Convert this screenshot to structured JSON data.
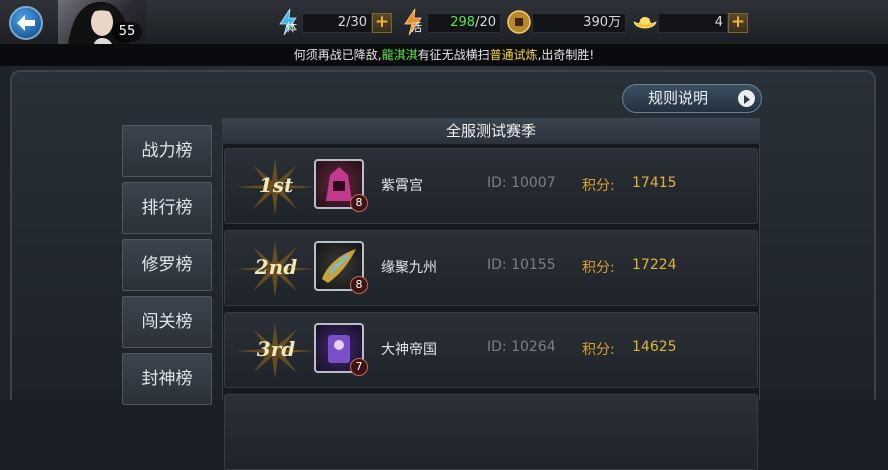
{
  "topbar": {
    "level": "55",
    "stamina": {
      "label": "体",
      "value": "2/30"
    },
    "vitality": {
      "label": "活",
      "value": "298",
      "max": "/20"
    },
    "coins": {
      "value": "390万"
    },
    "gold": {
      "value": "4"
    },
    "plus_label": "+"
  },
  "marquee": {
    "part1": "何须再战已降敌,",
    "name": "龍淇淇",
    "part2": "有征无战横扫",
    "mode": "普通试炼",
    "part3": ",出奇制胜!"
  },
  "rules_button": "规则说明",
  "tabs": [
    {
      "label": "战力榜"
    },
    {
      "label": "排行榜"
    },
    {
      "label": "修罗榜"
    },
    {
      "label": "闯关榜"
    },
    {
      "label": "封神榜"
    }
  ],
  "season_title": "全服测试赛季",
  "rankings": [
    {
      "rank": "1st",
      "level": "8",
      "name": "紫霄宫",
      "id": "ID: 10007",
      "score_label": "积分:",
      "score": "17415",
      "icon_color": "#c23a8c"
    },
    {
      "rank": "2nd",
      "level": "8",
      "name": "缘聚九州",
      "id": "ID: 10155",
      "score_label": "积分:",
      "score": "17224",
      "icon_color": "#c8a33a"
    },
    {
      "rank": "3rd",
      "level": "7",
      "name": "大神帝国",
      "id": "ID: 10264",
      "score_label": "积分:",
      "score": "14625",
      "icon_color": "#7a4fc9"
    }
  ]
}
